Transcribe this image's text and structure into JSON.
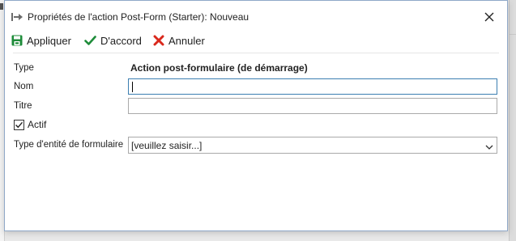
{
  "window": {
    "title": "Propriétés de l'action Post-Form (Starter): Nouveau",
    "icon": "arrow-right-icon"
  },
  "toolbar": {
    "apply_label": "Appliquer",
    "ok_label": "D'accord",
    "cancel_label": "Annuler"
  },
  "form": {
    "type_label": "Type",
    "type_value": "Action post-formulaire (de démarrage)",
    "name_label": "Nom",
    "name_value": "",
    "title_label": "Titre",
    "title_value": "",
    "active_label": "Actif",
    "active_checked": true,
    "entity_type_label": "Type d'entité de formulaire",
    "entity_type_value": "[veuillez saisir...]"
  },
  "colors": {
    "apply_icon": "#1e8c3a",
    "ok_icon": "#1e8c3a",
    "cancel_icon": "#d9281c",
    "focus_border": "#3c7fb1"
  }
}
